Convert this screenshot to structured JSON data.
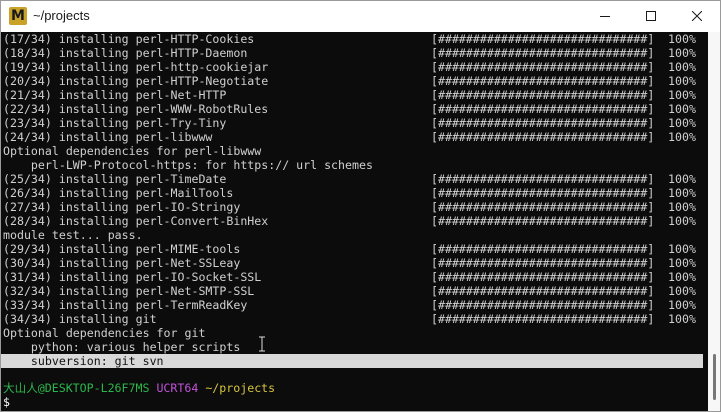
{
  "window": {
    "title": "~/projects",
    "app_icon_letter": "M"
  },
  "progress_rows": [
    {
      "text": "(17/34) installing perl-HTTP-Cookies",
      "bar": "[##############################]",
      "percent": "100%"
    },
    {
      "text": "(18/34) installing perl-HTTP-Daemon",
      "bar": "[##############################]",
      "percent": "100%"
    },
    {
      "text": "(19/34) installing perl-http-cookiejar",
      "bar": "[##############################]",
      "percent": "100%"
    },
    {
      "text": "(20/34) installing perl-HTTP-Negotiate",
      "bar": "[##############################]",
      "percent": "100%"
    },
    {
      "text": "(21/34) installing perl-Net-HTTP",
      "bar": "[##############################]",
      "percent": "100%"
    },
    {
      "text": "(22/34) installing perl-WWW-RobotRules",
      "bar": "[##############################]",
      "percent": "100%"
    },
    {
      "text": "(23/34) installing perl-Try-Tiny",
      "bar": "[##############################]",
      "percent": "100%"
    },
    {
      "text": "(24/34) installing perl-libwww",
      "bar": "[##############################]",
      "percent": "100%"
    },
    {
      "text": "Optional dependencies for perl-libwww",
      "bar": "",
      "percent": ""
    },
    {
      "text": "    perl-LWP-Protocol-https: for https:// url schemes",
      "bar": "",
      "percent": ""
    },
    {
      "text": "(25/34) installing perl-TimeDate",
      "bar": "[##############################]",
      "percent": "100%"
    },
    {
      "text": "(26/34) installing perl-MailTools",
      "bar": "[##############################]",
      "percent": "100%"
    },
    {
      "text": "(27/34) installing perl-IO-Stringy",
      "bar": "[##############################]",
      "percent": "100%"
    },
    {
      "text": "(28/34) installing perl-Convert-BinHex",
      "bar": "[##############################]",
      "percent": "100%"
    },
    {
      "text": "module test... pass.",
      "bar": "",
      "percent": ""
    },
    {
      "text": "(29/34) installing perl-MIME-tools",
      "bar": "[##############################]",
      "percent": "100%"
    },
    {
      "text": "(30/34) installing perl-Net-SSLeay",
      "bar": "[##############################]",
      "percent": "100%"
    },
    {
      "text": "(31/34) installing perl-IO-Socket-SSL",
      "bar": "[##############################]",
      "percent": "100%"
    },
    {
      "text": "(32/34) installing perl-Net-SMTP-SSL",
      "bar": "[##############################]",
      "percent": "100%"
    },
    {
      "text": "(33/34) installing perl-TermReadKey",
      "bar": "[##############################]",
      "percent": "100%"
    },
    {
      "text": "(34/34) installing git",
      "bar": "[##############################]",
      "percent": "100%"
    },
    {
      "text": "Optional dependencies for git",
      "bar": "",
      "percent": ""
    },
    {
      "text": "    python: various helper scripts",
      "bar": "",
      "percent": ""
    }
  ],
  "highlighted_line": "    subversion: git svn",
  "prompt": {
    "user_host": "大山人@DESKTOP-L26F7MS",
    "env": "UCRT64",
    "path": "~/projects"
  },
  "input_line": "$"
}
